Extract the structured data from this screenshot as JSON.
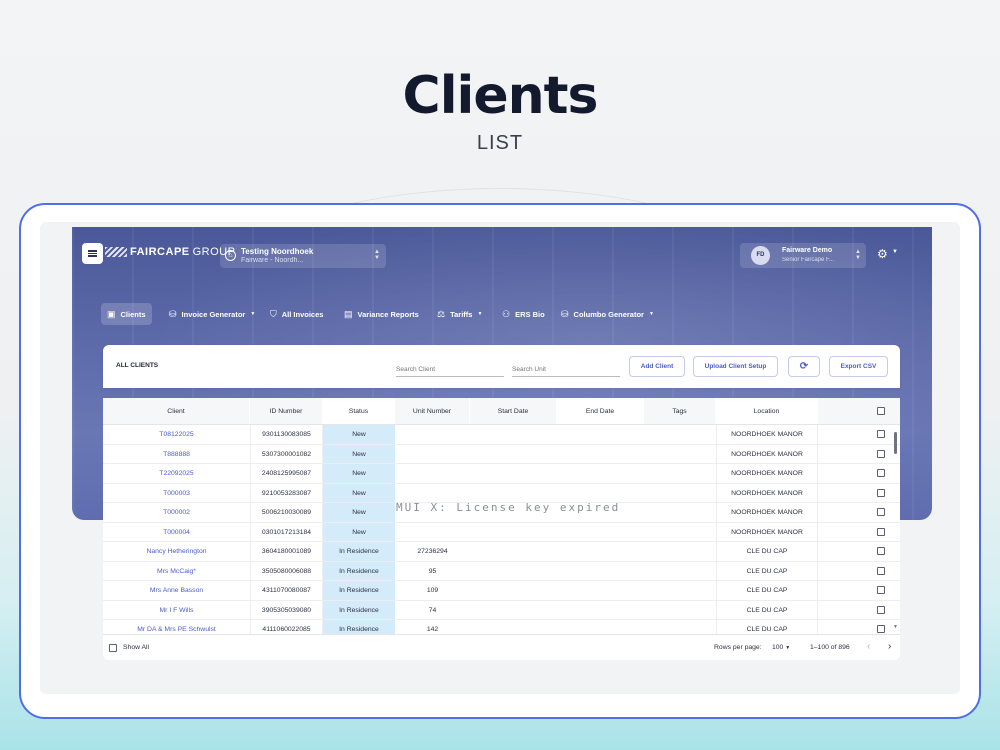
{
  "hero": {
    "title": "Clients",
    "subtitle": "LIST"
  },
  "app": {
    "logo_bold": "FAIRCAPE",
    "logo_rest": "GROUP",
    "workspace": {
      "title": "Testing Noordhoek",
      "subtitle": "Fairware - Noordh..."
    },
    "user": {
      "initials": "FD",
      "name": "Fairware Demo",
      "role": "Senior Faircape F..."
    }
  },
  "nav": [
    {
      "label": "Clients",
      "icon": "clients-icon",
      "glyph": "▣",
      "caret": false,
      "active": true
    },
    {
      "label": "Invoice Generator",
      "icon": "invoice-icon",
      "glyph": "⛁",
      "caret": true,
      "active": false
    },
    {
      "label": "All Invoices",
      "icon": "shield-icon",
      "glyph": "⛉",
      "caret": false,
      "active": false
    },
    {
      "label": "Variance Reports",
      "icon": "report-icon",
      "glyph": "▤",
      "caret": false,
      "active": false
    },
    {
      "label": "Tariffs",
      "icon": "tariff-icon",
      "glyph": "⚖",
      "caret": true,
      "active": false
    },
    {
      "label": "ERS Bio",
      "icon": "bio-icon",
      "glyph": "⚇",
      "caret": false,
      "active": false
    },
    {
      "label": "Columbo Generator",
      "icon": "columbo-icon",
      "glyph": "⛁",
      "caret": true,
      "active": false
    }
  ],
  "panel": {
    "title": "ALL CLIENTS",
    "search_client_placeholder": "Search Client",
    "search_unit_placeholder": "Search Unit",
    "add_client": "Add Client",
    "upload_setup": "Upload Client Setup",
    "refresh_glyph": "⟳",
    "export_csv": "Export CSV"
  },
  "table": {
    "columns": [
      "Client",
      "ID Number",
      "Status",
      "Unit Number",
      "Start Date",
      "End Date",
      "Tags",
      "Location"
    ],
    "rows": [
      {
        "client": "T08122025",
        "id": "9301130083085",
        "status": "New",
        "unit": "",
        "start": "",
        "end": "",
        "tags": "",
        "location": "NOORDHOEK MANOR"
      },
      {
        "client": "T888888",
        "id": "5307300001082",
        "status": "New",
        "unit": "",
        "start": "",
        "end": "",
        "tags": "",
        "location": "NOORDHOEK MANOR"
      },
      {
        "client": "T22092025",
        "id": "2408125995087",
        "status": "New",
        "unit": "",
        "start": "",
        "end": "",
        "tags": "",
        "location": "NOORDHOEK MANOR"
      },
      {
        "client": "T000003",
        "id": "9210053283087",
        "status": "New",
        "unit": "",
        "start": "",
        "end": "",
        "tags": "",
        "location": "NOORDHOEK MANOR"
      },
      {
        "client": "T000002",
        "id": "5006210030089",
        "status": "New",
        "unit": "",
        "start": "",
        "end": "",
        "tags": "",
        "location": "NOORDHOEK MANOR"
      },
      {
        "client": "T000004",
        "id": "0301017213184",
        "status": "New",
        "unit": "",
        "start": "",
        "end": "",
        "tags": "",
        "location": "NOORDHOEK MANOR"
      },
      {
        "client": "Nancy Hetherington",
        "id": "3604180001089",
        "status": "In Residence",
        "unit": "27236294",
        "start": "",
        "end": "",
        "tags": "",
        "location": "CLE DU CAP"
      },
      {
        "client": "Mrs McCaig*",
        "id": "3505080006088",
        "status": "In Residence",
        "unit": "95",
        "start": "",
        "end": "",
        "tags": "",
        "location": "CLE DU CAP"
      },
      {
        "client": "Mrs Anne Basson",
        "id": "4311070080087",
        "status": "In Residence",
        "unit": "109",
        "start": "",
        "end": "",
        "tags": "",
        "location": "CLE DU CAP"
      },
      {
        "client": "Mr I F Wills",
        "id": "3905305039080",
        "status": "In Residence",
        "unit": "74",
        "start": "",
        "end": "",
        "tags": "",
        "location": "CLE DU CAP"
      },
      {
        "client": "Mr DA & Mrs PE Schwulst",
        "id": "4111060022085",
        "status": "In Residence",
        "unit": "142",
        "start": "",
        "end": "",
        "tags": "",
        "location": "CLE DU CAP"
      }
    ]
  },
  "watermark": "MUI X: License key expired",
  "footer": {
    "show_all": "Show All",
    "rows_per_page_label": "Rows per page:",
    "rows_per_page_value": "100",
    "range": "1–100 of 896"
  },
  "colors": {
    "accent": "#4a5cc8",
    "status_bg": "#d4ebfa",
    "device_border": "#4f6ee8"
  }
}
